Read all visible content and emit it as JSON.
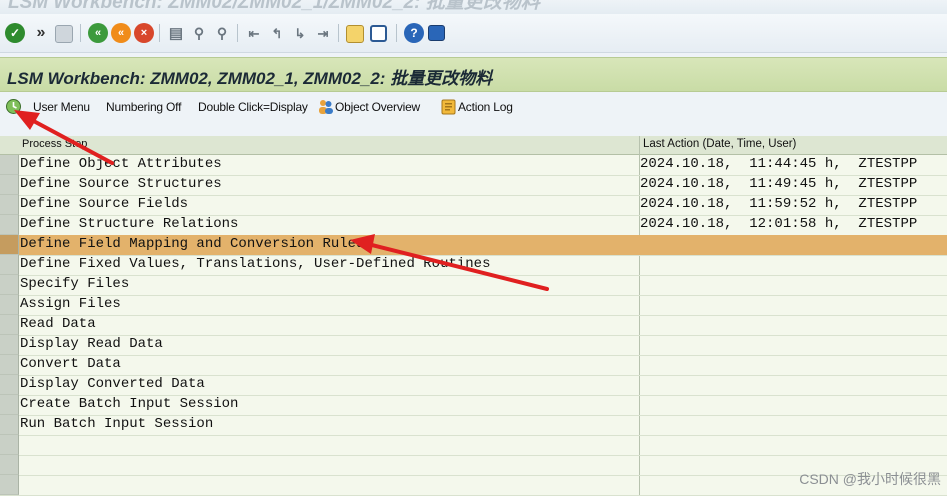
{
  "window_title": "LSM Workbench: ZMM02/ZMM02_1/ZMM02_2: 批量更改物料",
  "toolbar": {
    "icons": [
      "check-icon",
      "chevron-more-icon",
      "save-icon",
      "back-icon",
      "exit-icon",
      "cancel-icon",
      "print-icon",
      "find-icon",
      "find-next-icon",
      "first-page-icon",
      "prev-page-icon",
      "next-page-icon",
      "last-page-icon",
      "create-session-icon",
      "shortcut-icon",
      "help-icon",
      "layout-icon"
    ],
    "more_glyph": "»"
  },
  "title": "LSM Workbench: ZMM02, ZMM02_1, ZMM02_2: 批量更改物料",
  "app_toolbar": {
    "execute_icon": "execute-clock-icon",
    "user_menu": "User Menu",
    "numbering_off": "Numbering Off",
    "double_click": "Double Click=Display",
    "object_overview": "Object Overview",
    "object_overview_icon": "people-overview-icon",
    "action_log": "Action Log",
    "action_log_icon": "log-icon"
  },
  "table": {
    "headers": {
      "process_step": "Process Step",
      "last_action": "Last Action (Date, Time, User)"
    },
    "rows": [
      {
        "step": "Define Object Attributes",
        "last_action": "2024.10.18,  11:44:45 h,  ZTESTPP"
      },
      {
        "step": "Define Source Structures",
        "last_action": "2024.10.18,  11:49:45 h,  ZTESTPP"
      },
      {
        "step": "Define Source Fields",
        "last_action": "2024.10.18,  11:59:52 h,  ZTESTPP"
      },
      {
        "step": "Define Structure Relations",
        "last_action": "2024.10.18,  12:01:58 h,  ZTESTPP"
      },
      {
        "step": "Define Field Mapping and Conversion Rules",
        "last_action": ""
      },
      {
        "step": "Define Fixed Values, Translations, User-Defined Routines",
        "last_action": ""
      },
      {
        "step": "Specify Files",
        "last_action": ""
      },
      {
        "step": "Assign Files",
        "last_action": ""
      },
      {
        "step": "Read Data",
        "last_action": ""
      },
      {
        "step": "Display Read Data",
        "last_action": ""
      },
      {
        "step": "Convert Data",
        "last_action": ""
      },
      {
        "step": "Display Converted Data",
        "last_action": ""
      },
      {
        "step": "Create Batch Input Session",
        "last_action": ""
      },
      {
        "step": "Run Batch Input Session",
        "last_action": ""
      }
    ],
    "highlight_color": "#e3b26b"
  },
  "annotation_color": "#e02020",
  "watermark": "CSDN @我小时候很黑"
}
